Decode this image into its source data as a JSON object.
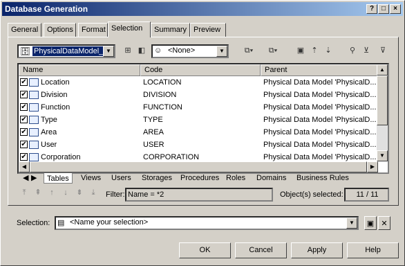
{
  "window": {
    "title": "Database Generation"
  },
  "tabs": [
    "General",
    "Options",
    "Format",
    "Selection",
    "Summary",
    "Preview"
  ],
  "model_combo": {
    "value": "PhysicalDataModel_1"
  },
  "owner_combo": {
    "value": "<None>"
  },
  "table": {
    "columns": [
      "Name",
      "Code",
      "Parent"
    ],
    "rows": [
      {
        "name": "Location",
        "code": "LOCATION",
        "parent": "Physical Data Model 'PhysicalD..."
      },
      {
        "name": "Division",
        "code": "DIVISION",
        "parent": "Physical Data Model 'PhysicalD..."
      },
      {
        "name": "Function",
        "code": "FUNCTION",
        "parent": "Physical Data Model 'PhysicalD..."
      },
      {
        "name": "Type",
        "code": "TYPE",
        "parent": "Physical Data Model 'PhysicalD..."
      },
      {
        "name": "Area",
        "code": "AREA",
        "parent": "Physical Data Model 'PhysicalD..."
      },
      {
        "name": "User",
        "code": "USER",
        "parent": "Physical Data Model 'PhysicalD..."
      },
      {
        "name": "Corporation",
        "code": "CORPORATION",
        "parent": "Physical Data Model 'PhysicalD..."
      }
    ]
  },
  "bottom_tabs": [
    "Tables",
    "Views",
    "Users",
    "Storages",
    "Procedures",
    "Roles",
    "Domains",
    "Business Rules"
  ],
  "filter": {
    "label": "Filter:",
    "value": "Name = *2"
  },
  "objects_selected": {
    "label": "Object(s) selected:",
    "value": "11 / 11"
  },
  "selection": {
    "label": "Selection:",
    "placeholder": "<Name your selection>"
  },
  "buttons": {
    "ok": "OK",
    "cancel": "Cancel",
    "apply": "Apply",
    "help": "Help"
  }
}
